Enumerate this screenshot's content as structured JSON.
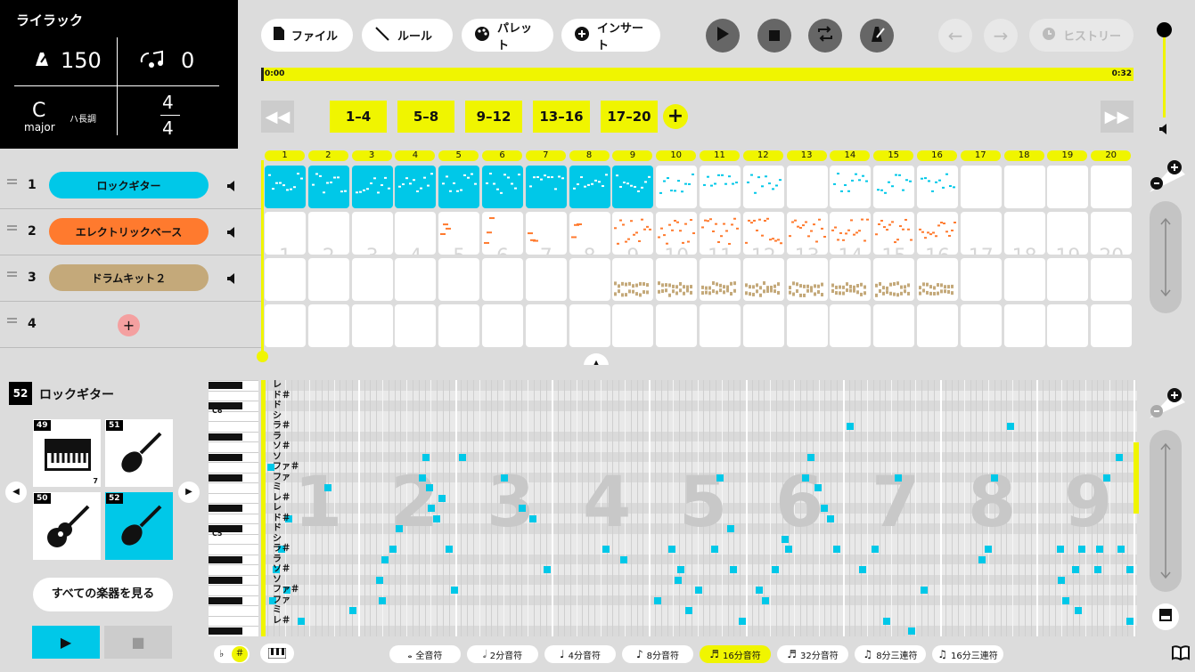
{
  "song": {
    "title": "ライラック",
    "tempo": "150",
    "transpose": "0",
    "key": "C",
    "key_mode": "major",
    "key_jp": "ハ長調",
    "time_sig_top": "4",
    "time_sig_bottom": "4"
  },
  "toolbar": {
    "file": "ファイル",
    "rule": "ルール",
    "palette": "パレット",
    "insert": "インサート",
    "history": "ヒストリー"
  },
  "timeline": {
    "start": "0:00",
    "end": "0:32"
  },
  "ranges": [
    "1–4",
    "5–8",
    "9–12",
    "13–16",
    "17–20"
  ],
  "bars": [
    "1",
    "2",
    "3",
    "4",
    "5",
    "6",
    "7",
    "8",
    "9",
    "10",
    "11",
    "12",
    "13",
    "14",
    "15",
    "16",
    "17",
    "18",
    "19",
    "20"
  ],
  "tracks": [
    {
      "num": "1",
      "name": "ロックギター",
      "color": "#00c8e8"
    },
    {
      "num": "2",
      "name": "エレクトリックベース",
      "color": "#ff7a2e"
    },
    {
      "num": "3",
      "name": "ドラムキット２",
      "color": "#c4a97a"
    },
    {
      "num": "4",
      "name": "",
      "color": ""
    }
  ],
  "instrument_panel": {
    "id": "52",
    "name": "ロックギター",
    "items": [
      {
        "num": "49",
        "badge": "7"
      },
      {
        "num": "51"
      },
      {
        "num": "50"
      },
      {
        "num": "52"
      }
    ],
    "see_all": "すべての楽器を見る"
  },
  "piano": {
    "c6": "C6",
    "c5": "C5"
  },
  "pitches": [
    "レ",
    "ド＃",
    "ド",
    "シ",
    "ラ＃",
    "ラ",
    "ソ＃",
    "ソ",
    "ファ＃",
    "ファ",
    "ミ",
    "レ＃",
    "レ",
    "ド＃",
    "ド",
    "シ",
    "ラ＃",
    "ラ",
    "ソ＃",
    "ソ",
    "ファ＃",
    "ファ",
    "ミ",
    "レ＃"
  ],
  "beat_ghost": [
    "1",
    "2",
    "3",
    "4",
    "5",
    "6",
    "7",
    "8",
    "9"
  ],
  "note_lengths": [
    "全音符",
    "2分音符",
    "4分音符",
    "8分音符",
    "16分音符",
    "32分音符",
    "8分三連符",
    "16分三連符"
  ],
  "accidentals": {
    "flat": "♭",
    "sharp": "＃"
  },
  "colors": {
    "accent": "#f0f500",
    "guitar": "#00c8e8",
    "bass": "#ff7a2e",
    "drums": "#c4a97a"
  }
}
